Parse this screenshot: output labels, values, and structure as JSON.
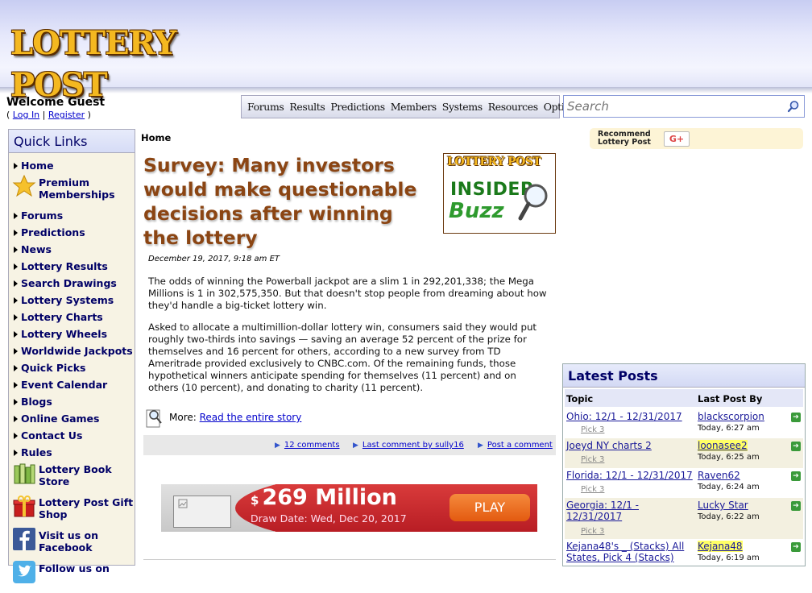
{
  "header": {
    "logo_text": "LOTTERY POST"
  },
  "user": {
    "welcome": "Welcome Guest",
    "login": "Log In",
    "register": "Register"
  },
  "nav": [
    "Forums",
    "Results",
    "Predictions",
    "Members",
    "Systems",
    "Resources",
    "Options"
  ],
  "search": {
    "placeholder": "Search"
  },
  "quick_links": {
    "title": "Quick Links",
    "items": [
      {
        "label": "Home",
        "icon": "arrow"
      },
      {
        "label": "Premium Memberships",
        "icon": "star-icon"
      },
      {
        "label": "Forums",
        "icon": "arrow"
      },
      {
        "label": "Predictions",
        "icon": "arrow"
      },
      {
        "label": "News",
        "icon": "arrow"
      },
      {
        "label": "Lottery Results",
        "icon": "arrow"
      },
      {
        "label": "Search Drawings",
        "icon": "arrow"
      },
      {
        "label": "Lottery Systems",
        "icon": "arrow"
      },
      {
        "label": "Lottery Charts",
        "icon": "arrow"
      },
      {
        "label": "Lottery Wheels",
        "icon": "arrow"
      },
      {
        "label": "Worldwide Jackpots",
        "icon": "arrow"
      },
      {
        "label": "Quick Picks",
        "icon": "arrow"
      },
      {
        "label": "Event Calendar",
        "icon": "arrow"
      },
      {
        "label": "Blogs",
        "icon": "arrow"
      },
      {
        "label": "Online Games",
        "icon": "arrow"
      },
      {
        "label": "Contact Us",
        "icon": "arrow"
      },
      {
        "label": "Rules",
        "icon": "arrow"
      },
      {
        "label": "Lottery Book Store",
        "icon": "books-icon"
      },
      {
        "label": "Lottery Post Gift Shop",
        "icon": "gift-icon"
      },
      {
        "label": "Visit us on Facebook",
        "icon": "facebook-icon"
      },
      {
        "label": "Follow us on",
        "icon": "twitter-icon"
      }
    ]
  },
  "breadcrumb": "Home",
  "article": {
    "title": "Survey: Many investors would make questionable decisions after winning the lottery",
    "badge_brand": "LOTTERY POST",
    "badge_line1": "INSIDER",
    "badge_line2": "Buzz",
    "date": "December 19, 2017, 9:18 am ET",
    "paragraphs": [
      "The odds of winning the Powerball jackpot are a slim 1 in 292,201,338; the Mega Millions is 1 in 302,575,350. But that doesn't stop people from dreaming about how they'd handle a big-ticket lottery win.",
      "Asked to allocate a multimillion-dollar lottery win, consumers said they would put roughly two-thirds into savings — saving an average 52 percent of the prize for themselves and 16 percent for others, according to a new survey from TD Ameritrade provided exclusively to CNBC.com. Of the remaining funds, those hypothetical winners anticipate spending for themselves (11 percent) and on others (10 percent), and donating to charity (11 percent)."
    ],
    "more_label": "More:",
    "more_link": "Read the entire story",
    "comments": "12 comments",
    "last_comment": "Last comment by sully16",
    "post_comment": "Post a comment"
  },
  "ad": {
    "dollar": "$",
    "amount": "269 Million",
    "draw_date": "Draw Date: Wed, Dec 20, 2017",
    "play": "PLAY"
  },
  "recommend": {
    "line1": "Recommend",
    "line2": "Lottery Post",
    "gplus": "G+"
  },
  "latest_posts": {
    "title": "Latest Posts",
    "col_topic": "Topic",
    "col_last": "Last Post By",
    "rows": [
      {
        "topic": "Ohio: 12/1 - 12/31/2017",
        "sub": "Pick 3",
        "user": "blackscorpion",
        "time": "Today, 6:27 am",
        "highlight": false
      },
      {
        "topic": "Joeyd NY charts 2",
        "sub": "Pick 3",
        "user": "loonasee2",
        "time": "Today, 6:25 am",
        "highlight": true
      },
      {
        "topic": "Florida: 12/1 - 12/31/2017",
        "sub": "Pick 3",
        "user": "Raven62",
        "time": "Today, 6:24 am",
        "highlight": false
      },
      {
        "topic": "Georgia: 12/1 - 12/31/2017",
        "sub": "Pick 3",
        "user": "Lucky Star",
        "time": "Today, 6:22 am",
        "highlight": false
      },
      {
        "topic": "Kejana48's _ (Stacks) All States, Pick 4 (Stacks)",
        "sub": "",
        "user": "Kejana48",
        "time": "Today, 6:19 am",
        "highlight": true
      }
    ]
  }
}
